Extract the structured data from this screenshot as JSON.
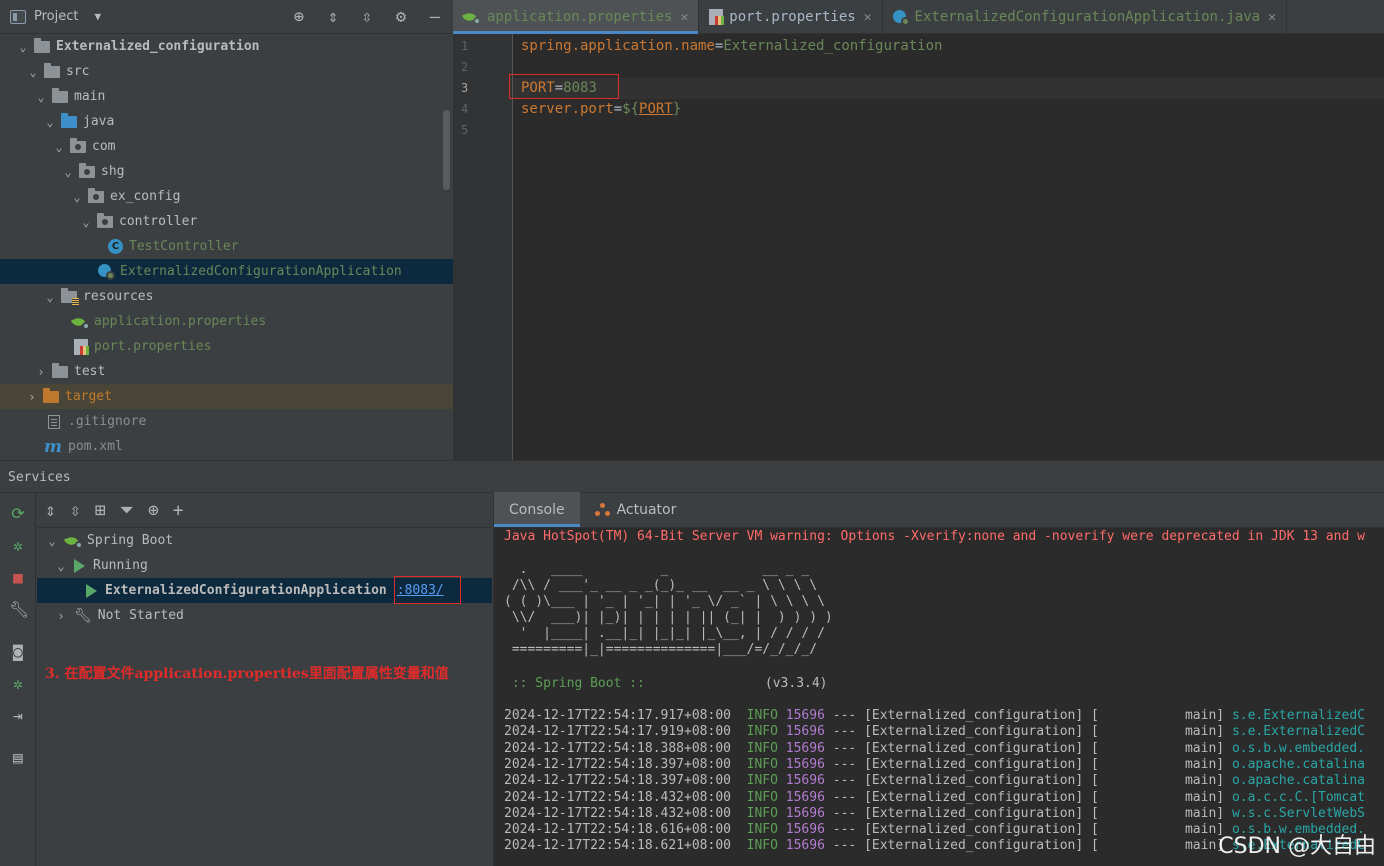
{
  "project": {
    "title": "Project",
    "tree": [
      {
        "label": "Externalized_configuration"
      },
      {
        "label": "src"
      },
      {
        "label": "main"
      },
      {
        "label": "java"
      },
      {
        "label": "com"
      },
      {
        "label": "shg"
      },
      {
        "label": "ex_config"
      },
      {
        "label": "controller"
      },
      {
        "label": "TestController"
      },
      {
        "label": "ExternalizedConfigurationApplication"
      },
      {
        "label": "resources"
      },
      {
        "label": "application.properties"
      },
      {
        "label": "port.properties"
      },
      {
        "label": "test"
      },
      {
        "label": "target"
      },
      {
        "label": ".gitignore"
      },
      {
        "label": "pom.xml"
      }
    ]
  },
  "editor": {
    "tabs": [
      {
        "label": "application.properties",
        "active": true
      },
      {
        "label": "port.properties"
      },
      {
        "label": "ExternalizedConfigurationApplication.java"
      }
    ],
    "line_numbers": [
      "1",
      "2",
      "3",
      "4",
      "5"
    ],
    "lines": {
      "l1_key": "spring.application.name",
      "l1_eq": "=",
      "l1_val": "Externalized_configuration",
      "l3_key": "PORT",
      "l3_eq": "=",
      "l3_val": "8083",
      "l4_key": "server.port",
      "l4_eq": "=",
      "l4_open": "${",
      "l4_ref": "PORT",
      "l4_close": "}"
    }
  },
  "services": {
    "title": "Services",
    "tree": {
      "spring_boot": "Spring Boot",
      "running": "Running",
      "app": "ExternalizedConfigurationApplication",
      "port_link": ":8083/",
      "not_started": "Not Started"
    },
    "annotation": "3. 在配置文件application.properties里面配置属性变量和值"
  },
  "console": {
    "tabs": [
      "Console",
      "Actuator"
    ],
    "warning": "Java HotSpot(TM) 64-Bit Server VM warning: Options -Xverify:none and -noverify were deprecated in JDK 13 and w",
    "banner": [
      "  .   ____          _            __ _ _",
      " /\\\\ / ___'_ __ _ _(_)_ __  __ _ \\ \\ \\ \\",
      "( ( )\\___ | '_ | '_| | '_ \\/ _` | \\ \\ \\ \\",
      " \\\\/  ___)| |_)| | | | | || (_| |  ) ) ) )",
      "  '  |____| .__|_| |_|_| |_\\__, | / / / /",
      " =========|_|==============|___/=/_/_/_/"
    ],
    "boot_label": " :: Spring Boot ::",
    "boot_version": "(v3.3.4)",
    "logs": [
      {
        "ts": "2024-12-17T22:54:17.917+08:00",
        "level": "INFO",
        "pid": "15696",
        "sep": "---",
        "app": "[Externalized_configuration] [",
        "thread": "main]",
        "logger": "s.e.ExternalizedC"
      },
      {
        "ts": "2024-12-17T22:54:17.919+08:00",
        "level": "INFO",
        "pid": "15696",
        "sep": "---",
        "app": "[Externalized_configuration] [",
        "thread": "main]",
        "logger": "s.e.ExternalizedC"
      },
      {
        "ts": "2024-12-17T22:54:18.388+08:00",
        "level": "INFO",
        "pid": "15696",
        "sep": "---",
        "app": "[Externalized_configuration] [",
        "thread": "main]",
        "logger": "o.s.b.w.embedded."
      },
      {
        "ts": "2024-12-17T22:54:18.397+08:00",
        "level": "INFO",
        "pid": "15696",
        "sep": "---",
        "app": "[Externalized_configuration] [",
        "thread": "main]",
        "logger": "o.apache.catalina"
      },
      {
        "ts": "2024-12-17T22:54:18.397+08:00",
        "level": "INFO",
        "pid": "15696",
        "sep": "---",
        "app": "[Externalized_configuration] [",
        "thread": "main]",
        "logger": "o.apache.catalina"
      },
      {
        "ts": "2024-12-17T22:54:18.432+08:00",
        "level": "INFO",
        "pid": "15696",
        "sep": "---",
        "app": "[Externalized_configuration] [",
        "thread": "main]",
        "logger": "o.a.c.c.C.[Tomcat"
      },
      {
        "ts": "2024-12-17T22:54:18.432+08:00",
        "level": "INFO",
        "pid": "15696",
        "sep": "---",
        "app": "[Externalized_configuration] [",
        "thread": "main]",
        "logger": "w.s.c.ServletWebS"
      },
      {
        "ts": "2024-12-17T22:54:18.616+08:00",
        "level": "INFO",
        "pid": "15696",
        "sep": "---",
        "app": "[Externalized_configuration] [",
        "thread": "main]",
        "logger": "o.s.b.w.embedded."
      },
      {
        "ts": "2024-12-17T22:54:18.621+08:00",
        "level": "INFO",
        "pid": "15696",
        "sep": "---",
        "app": "[Externalized_configuration] [",
        "thread": "main]",
        "logger": "s.e.ExternalizedC"
      }
    ]
  },
  "watermark": "CSDN @大自由",
  "colors": {
    "background": "#2b2b2b",
    "panel": "#3c3f41",
    "selection": "#0d293e",
    "accent": "#4a88c7",
    "keyword": "#cc7832",
    "value": "#6a8759",
    "highlight_box": "#e02b2b"
  }
}
